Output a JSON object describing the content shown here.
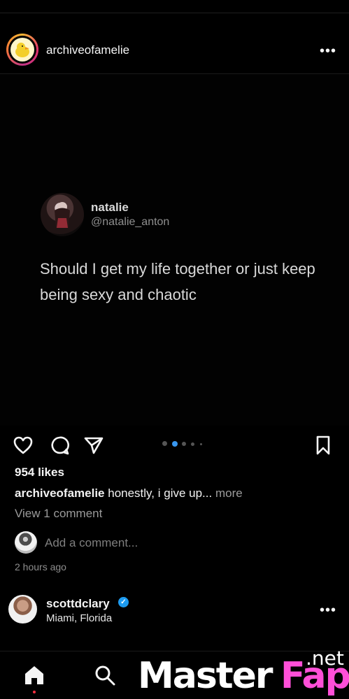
{
  "post": {
    "username": "archiveofamelie",
    "tweet": {
      "name": "natalie",
      "handle": "@natalie_anton",
      "text": "Should I get my life together or just keep being sexy and chaotic"
    },
    "likes": "954 likes",
    "caption_user": "archiveofamelie",
    "caption_text": " honestly, i give up...",
    "caption_more": " more",
    "view_comments": "View 1 comment",
    "add_comment_placeholder": "Add a comment...",
    "time": "2 hours ago",
    "carousel": {
      "total": 5,
      "active_index": 1
    }
  },
  "next_post": {
    "username": "scottdclary",
    "location": "Miami, Florida"
  },
  "icons": {
    "more": "more-options-icon",
    "like": "heart-icon",
    "comment": "comment-icon",
    "share": "share-icon",
    "save": "bookmark-icon",
    "home": "home-icon",
    "search": "search-icon"
  },
  "watermark": {
    "left": "Master",
    "right": "Fap",
    "suffix": ".net"
  },
  "colors": {
    "background": "#000000",
    "verified": "#1d9bf0",
    "notification_dot": "#ff3040",
    "watermark_accent": "#ff4fd8"
  }
}
